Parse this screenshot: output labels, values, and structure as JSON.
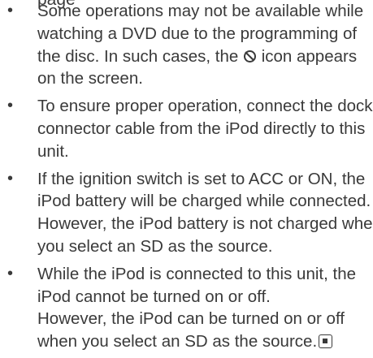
{
  "top_fragment": "page",
  "bullet_char": "•",
  "notes": [
    {
      "lines": [
        "Some operations may not be available while",
        "watching a DVD due to the programming of",
        "the disc. In such cases, the",
        "icon appears",
        "on the screen."
      ]
    },
    {
      "lines": [
        "To ensure proper operation, connect the dock",
        "connector cable from the iPod directly to this",
        "unit."
      ]
    },
    {
      "lines": [
        "If the ignition switch is set to ACC or ON, the",
        "iPod battery will be charged while connected.",
        "However, the iPod battery is not charged when",
        "you select an SD as the source."
      ]
    },
    {
      "lines": [
        "While the iPod is connected to this unit, the",
        "iPod cannot be turned on or off.",
        "However, the iPod can be turned on or off",
        "when you select an SD as the source."
      ]
    }
  ],
  "icons": {
    "prohibit": "prohibited-icon",
    "end_of_section": "end-of-section-icon"
  }
}
